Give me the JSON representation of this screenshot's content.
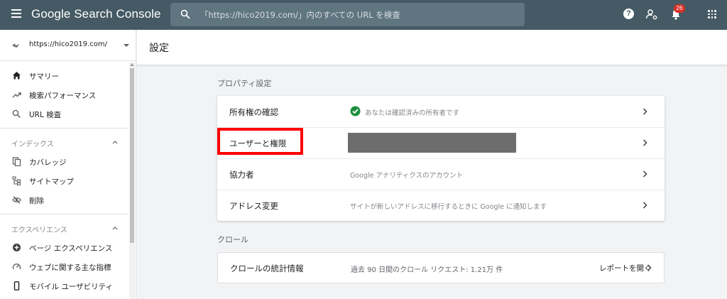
{
  "topbar": {
    "app_title": "Google Search Console",
    "search_placeholder": "「https://hico2019.com/」内のすべての URL を検査",
    "notification_count": "26",
    "colors": {
      "bar": "#455a64",
      "badge": "#d93025"
    }
  },
  "sidebar": {
    "property_url": "https://hico2019.com/",
    "top_items": [
      {
        "label": "サマリー",
        "icon": "home-icon"
      },
      {
        "label": "検索パフォーマンス",
        "icon": "trending-up-icon"
      },
      {
        "label": "URL 検査",
        "icon": "search-icon"
      }
    ],
    "sections": [
      {
        "title": "インデックス",
        "items": [
          {
            "label": "カバレッジ",
            "icon": "copy-icon"
          },
          {
            "label": "サイトマップ",
            "icon": "sitemap-icon"
          },
          {
            "label": "削除",
            "icon": "visibility-off-icon"
          }
        ]
      },
      {
        "title": "エクスペリエンス",
        "items": [
          {
            "label": "ページ エクスペリエンス",
            "icon": "plus-circle-icon"
          },
          {
            "label": "ウェブに関する主な指標",
            "icon": "speed-icon"
          },
          {
            "label": "モバイル ユーザビリティ",
            "icon": "smartphone-icon"
          }
        ]
      }
    ]
  },
  "main": {
    "page_title": "設定",
    "property_settings": {
      "heading": "プロパティ設定",
      "rows": [
        {
          "label": "所有権の確認",
          "value": "あなたは確認済みの所有者です"
        },
        {
          "label": "ユーザーと権限",
          "value": ""
        },
        {
          "label": "協力者",
          "value": "Google アナリティクスのアカウント"
        },
        {
          "label": "アドレス変更",
          "value": "サイトが新しいアドレスに移行するときに Google に通知します"
        }
      ]
    },
    "crawl": {
      "heading": "クロール",
      "label": "クロールの統計情報",
      "value": "過去 90 日間のクロール リクエスト: 1.21万 件",
      "action": "レポートを開く"
    },
    "highlight_color": "#ff0000"
  }
}
